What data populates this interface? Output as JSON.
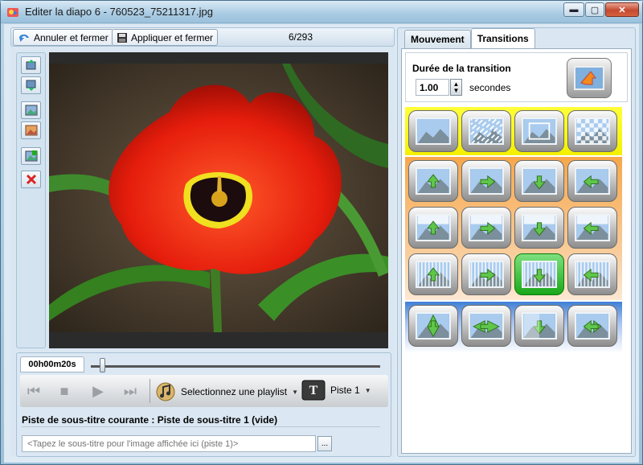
{
  "window": {
    "title": "Editer la diapo 6 - 760523_75211317.jpg",
    "min_glyph": "▬",
    "max_glyph": "▢",
    "close_glyph": "✕"
  },
  "toolbar": {
    "cancel_label": "Annuler et fermer",
    "apply_label": "Appliquer et fermer",
    "counter": "6/293"
  },
  "side_tools": [
    {
      "icon": "slide-swap-up-icon"
    },
    {
      "icon": "slide-swap-down-icon"
    },
    {
      "icon": "image-icon"
    },
    {
      "icon": "image-color-icon"
    },
    {
      "icon": "image-add-icon"
    },
    {
      "icon": "delete-icon"
    }
  ],
  "player": {
    "time": "00h00m20s",
    "playlist_label": "Selectionnez une playlist",
    "track_label": "Piste 1",
    "subtitle_status": "Piste de sous-titre courante : Piste de sous-titre 1 (vide)",
    "subtitle_placeholder": "<Tapez le sous-titre pour l'image affichée ici (piste 1)>",
    "more_label": "...",
    "seek_fraction": 0.03
  },
  "right": {
    "tabs": [
      "Mouvement",
      "Transitions"
    ],
    "active_tab": "Transitions",
    "duration_title": "Durée de la transition",
    "duration_value": "1.00",
    "duration_unit": "secondes"
  },
  "transitions": {
    "groups": [
      {
        "color": "#f4f000",
        "items": [
          "fade",
          "dissolve",
          "zoom",
          "checker"
        ]
      },
      {
        "color": "#f7a74a",
        "items": [
          "slide-up",
          "slide-right",
          "slide-down",
          "slide-left",
          "wipe-up",
          "wipe-right",
          "wipe-down",
          "wipe-left",
          "blinds-up",
          "blinds-right",
          "blinds-down",
          "blinds-left"
        ]
      },
      {
        "color": "#3f7fd6",
        "items": [
          "split-vertical",
          "split-horizontal",
          "center-in",
          "center-out"
        ]
      }
    ],
    "selected": "blinds-down"
  }
}
